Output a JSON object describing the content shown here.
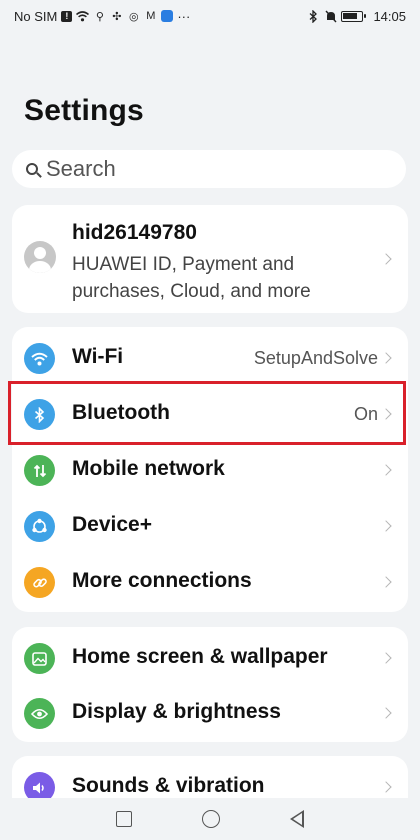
{
  "status_bar": {
    "carrier": "No SIM",
    "time": "14:05",
    "icons_left": [
      "sim-alert-icon",
      "wifi-icon",
      "usb-icon",
      "fan-icon",
      "whatsapp-icon",
      "gmail-icon",
      "cloud-icon"
    ],
    "overflow": "···",
    "icons_right": [
      "bluetooth-icon",
      "mute-icon",
      "battery-icon"
    ],
    "battery_level": 0.85
  },
  "header": {
    "title": "Settings"
  },
  "search": {
    "placeholder": "Search"
  },
  "account": {
    "name": "hid26149780",
    "subtitle": "HUAWEI ID, Payment and purchases, Cloud, and more"
  },
  "connectivity": [
    {
      "label": "Wi-Fi",
      "value": "SetupAndSolve",
      "icon": "wifi-icon",
      "color": "#3ea2e6"
    },
    {
      "label": "Bluetooth",
      "value": "On",
      "icon": "bluetooth-icon",
      "color": "#3ea2e6"
    },
    {
      "label": "Mobile network",
      "value": "",
      "icon": "signal-icon",
      "color": "#4cb457"
    },
    {
      "label": "Device+",
      "value": "",
      "icon": "device-plus-icon",
      "color": "#3ea2e6"
    },
    {
      "label": "More connections",
      "value": "",
      "icon": "link-icon",
      "color": "#f5a623"
    }
  ],
  "display": [
    {
      "label": "Home screen & wallpaper",
      "icon": "image-icon",
      "color": "#4cb457"
    },
    {
      "label": "Display & brightness",
      "icon": "eye-icon",
      "color": "#4cb457"
    }
  ],
  "sounds": [
    {
      "label": "Sounds & vibration",
      "icon": "speaker-icon",
      "color": "#7a5ce6"
    }
  ],
  "highlight_color": "#d9202a",
  "nav": [
    "recents-button",
    "home-button",
    "back-button"
  ]
}
